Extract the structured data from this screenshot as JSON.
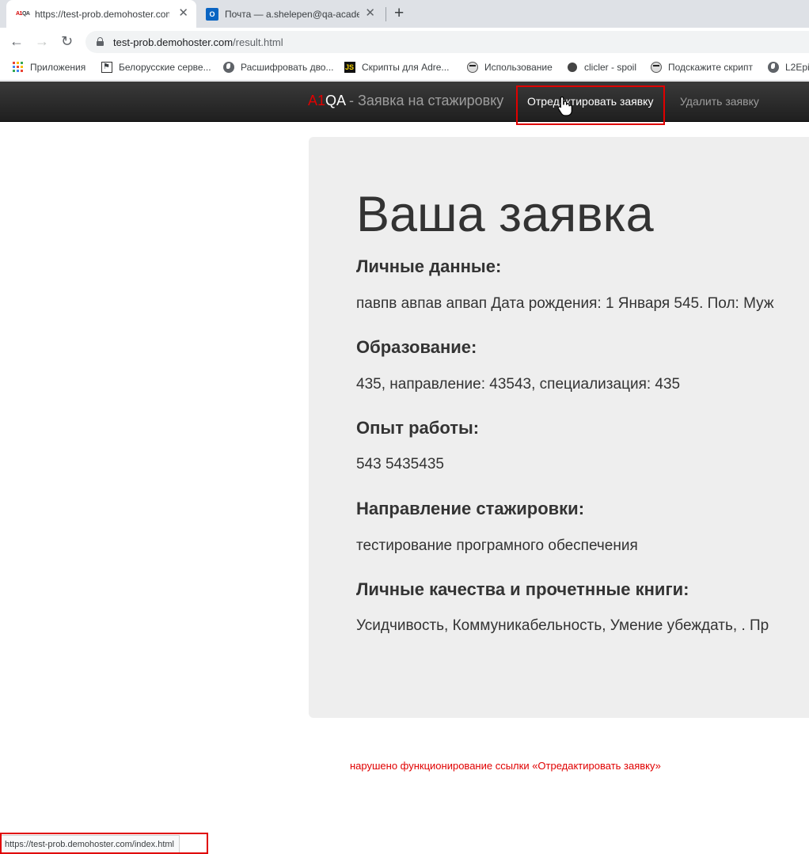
{
  "browser": {
    "tabs": [
      {
        "title": "https://test-prob.demohoster.com/result.html",
        "favicon": "a1qa-favicon",
        "active": true
      },
      {
        "title": "Почта — a.shelepen@qa-academy.by",
        "favicon": "outlook-icon",
        "active": false
      }
    ],
    "favicon_a1qa": {
      "a1": "A1",
      "qa": "QA"
    },
    "favicon_outlook": "O",
    "close_glyph": "✕",
    "new_tab_glyph": "+",
    "nav": {
      "back": "←",
      "forward": "→",
      "reload": "↻"
    },
    "url": {
      "host": "test-prob.demohoster.com",
      "path": "/result.html"
    },
    "bookmarks": [
      {
        "label": "Приложения",
        "icon": "apps-grid-icon"
      },
      {
        "label": "Белорусские серве...",
        "icon": "counter-strike-icon"
      },
      {
        "label": "Расшифровать дво...",
        "icon": "globe-icon"
      },
      {
        "label": "Скрипты для Adre...",
        "icon": "js-icon"
      },
      {
        "label": "Использование",
        "icon": "face-icon"
      },
      {
        "label": "clicler - spoil",
        "icon": "dot-icon"
      },
      {
        "label": "Подскажите скрипт",
        "icon": "face-icon"
      },
      {
        "label": "L2Epi",
        "icon": "globe-icon"
      }
    ],
    "status_url": "https://test-prob.demohoster.com/index.html"
  },
  "site": {
    "brand": {
      "a1": "A1",
      "qa": "QA",
      "rest": " - Заявка на стажировку"
    },
    "nav": {
      "edit": "Отредактировать заявку",
      "delete": "Удалить заявку"
    }
  },
  "application": {
    "title": "Ваша заявка",
    "sections": [
      {
        "heading": "Личные данные:",
        "text": "павпв авпав апвап Дата рождения: 1 Января 545. Пол: Муж"
      },
      {
        "heading": "Образование:",
        "text": "435, направление: 43543, специализация: 435"
      },
      {
        "heading": "Опыт работы:",
        "text": "543 5435435"
      },
      {
        "heading": "Направление стажировки:",
        "text": "тестирование програмного обеспечения"
      },
      {
        "heading": "Личные качества и прочетнные книги:",
        "text": "Усидчивость, Коммуникабельность, Умение убеждать, . Пр"
      }
    ]
  },
  "annotation": {
    "error_note": "нарушено функционирование ссылки «Отредактировать заявку»"
  },
  "colors": {
    "highlight": "#e00000",
    "navbar": "#222222",
    "card": "#eeeeee"
  }
}
